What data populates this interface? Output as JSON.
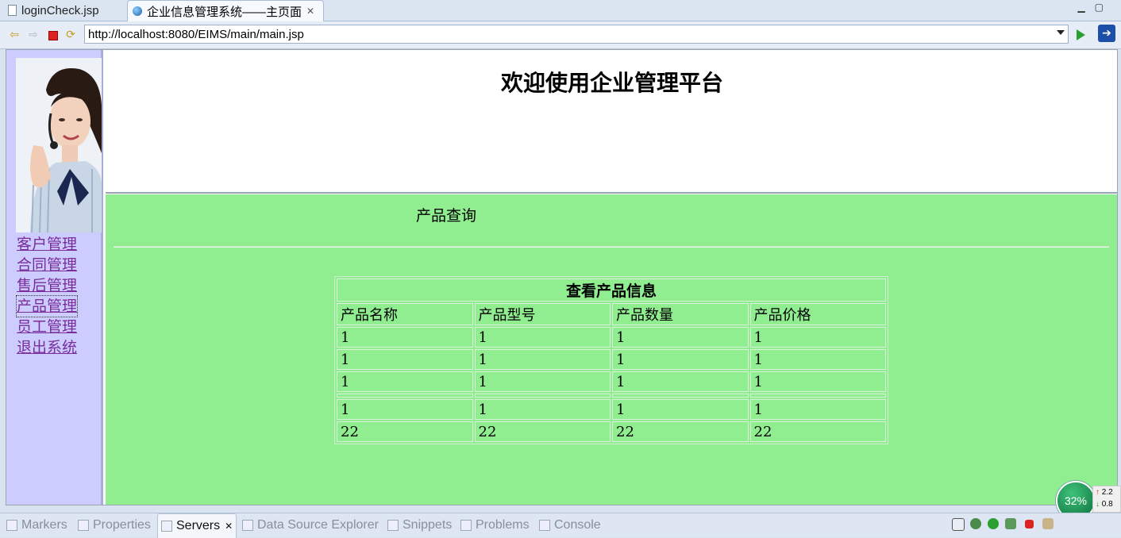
{
  "editor_tabs": [
    {
      "label": "loginCheck.jsp",
      "active": false
    },
    {
      "label": "企业信息管理系统——主页面",
      "active": true
    }
  ],
  "browser": {
    "url": "http://localhost:8080/EIMS/main/main.jsp"
  },
  "page": {
    "heading": "欢迎使用企业管理平台",
    "menu": [
      "客户管理",
      "合同管理",
      "售后管理",
      "产品管理",
      "员工管理",
      "退出系统"
    ],
    "section_title": "产品查询",
    "table": {
      "caption": "查看产品信息",
      "headers": [
        "产品名称",
        "产品型号",
        "产品数量",
        "产品价格"
      ],
      "rows": [
        [
          "1",
          "1",
          "1",
          "1"
        ],
        [
          "1",
          "1",
          "1",
          "1"
        ],
        [
          "1",
          "1",
          "1",
          "1"
        ],
        [
          "1",
          "1",
          "1",
          "1"
        ],
        [
          "22",
          "22",
          "22",
          "22"
        ]
      ]
    },
    "colors": {
      "content_bg": "#90ee90",
      "sidebar_bg": "#ccccff",
      "link": "#7a2c9b"
    }
  },
  "bottom_views": [
    "Markers",
    "Properties",
    "Servers",
    "Data Source Explorer",
    "Snippets",
    "Problems",
    "Console"
  ],
  "status": {
    "cpu_percent": "32%",
    "net_up": "2.2",
    "net_down": "0.8"
  }
}
